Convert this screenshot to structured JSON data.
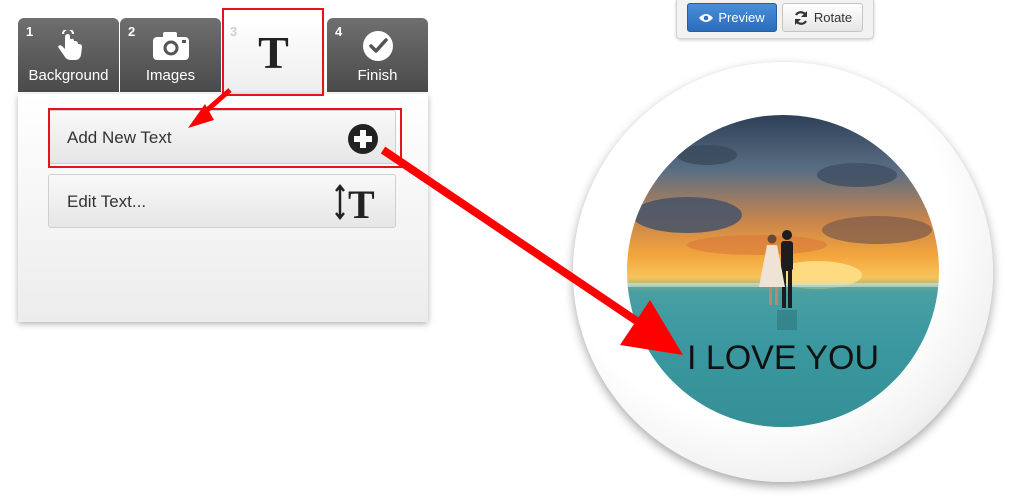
{
  "steps": [
    {
      "num": "1",
      "label": "Background",
      "icon": "hand-touch-icon"
    },
    {
      "num": "2",
      "label": "Images",
      "icon": "camera-icon"
    },
    {
      "num": "3",
      "label": "",
      "icon": "text-T-icon",
      "glyph": "T"
    },
    {
      "num": "4",
      "label": "Finish",
      "icon": "check-circle-icon"
    }
  ],
  "panel": {
    "add_text_label": "Add New Text",
    "edit_text_label": "Edit Text..."
  },
  "toolbar": {
    "preview_label": "Preview",
    "rotate_label": "Rotate"
  },
  "badge": {
    "text": "I LOVE YOU"
  },
  "colors": {
    "highlight": "#e5141c",
    "preview_button": "#2b6cbc",
    "tab_dark": "#555555"
  }
}
